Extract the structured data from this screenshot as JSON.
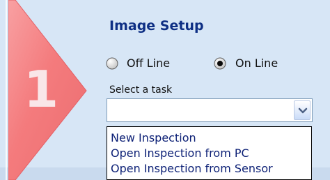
{
  "step": {
    "number": "1",
    "color": "#f47b7d"
  },
  "section": {
    "title": "Image Setup"
  },
  "radio_group": {
    "options": [
      {
        "label": "Off Line",
        "selected": false
      },
      {
        "label": "On Line",
        "selected": true
      }
    ]
  },
  "task_select": {
    "label": "Select a task",
    "value": "",
    "dropdown_items": [
      "New Inspection",
      "Open Inspection from PC",
      "Open Inspection from Sensor"
    ]
  },
  "icons": {
    "radio_unchecked": "radio-unchecked-icon",
    "radio_checked": "radio-checked-icon",
    "dropdown_arrow": "chevron-down-icon"
  },
  "colors": {
    "panel_background": "#d7e6f6",
    "title_text": "#0e2f84",
    "list_text": "#0b1f75",
    "input_border": "#7f9db9"
  }
}
